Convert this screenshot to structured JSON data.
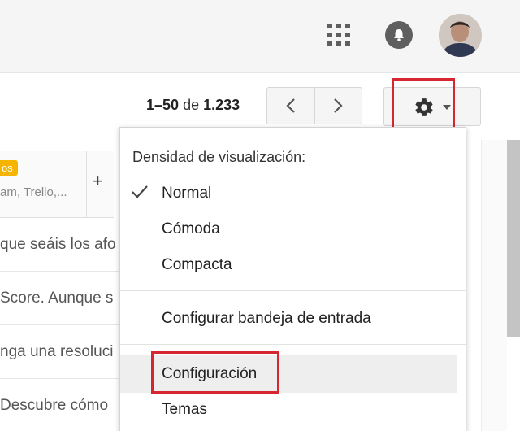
{
  "header": {
    "apps_icon": "apps-grid-icon",
    "notifications_icon": "bell-icon",
    "avatar": "user-avatar"
  },
  "toolbar": {
    "page_range": "1–50",
    "page_of": "de",
    "page_total": "1.233",
    "prev_icon": "chevron-left-icon",
    "next_icon": "chevron-right-icon",
    "settings_icon": "gear-icon",
    "accent_highlight": "#d6262f"
  },
  "inbox": {
    "tab_badge": "os",
    "tab_subtitle": "am, Trello,...",
    "add_tab": "+",
    "rows": [
      "que seáis los afo",
      "Score. Aunque s",
      "nga una resoluci",
      "Descubre cómo"
    ]
  },
  "settings_menu": {
    "heading": "Densidad de visualización:",
    "density_options": [
      {
        "label": "Normal",
        "selected": true
      },
      {
        "label": "Cómoda",
        "selected": false
      },
      {
        "label": "Compacta",
        "selected": false
      }
    ],
    "configure_inbox": "Configurar bandeja de entrada",
    "settings": "Configuración",
    "themes": "Temas"
  }
}
